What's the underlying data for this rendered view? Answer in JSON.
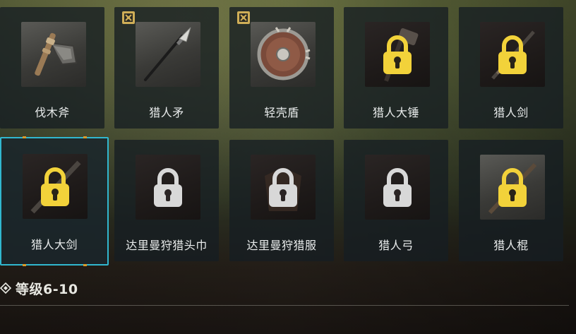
{
  "items": [
    {
      "name": "伐木斧",
      "locked": false,
      "icon": "axe-icon"
    },
    {
      "name": "猎人矛",
      "locked": false,
      "icon": "spear-icon",
      "badge": "book-icon"
    },
    {
      "name": "轻壳盾",
      "locked": false,
      "icon": "shield-icon",
      "badge": "book-icon"
    },
    {
      "name": "猎人大锤",
      "locked": true,
      "icon": "hammer-icon"
    },
    {
      "name": "猎人剑",
      "locked": true,
      "icon": "sword-icon"
    },
    {
      "name": "猎人大剑",
      "locked": true,
      "icon": "greatsword-icon",
      "selected": true
    },
    {
      "name": "达里曼狩猎头巾",
      "locked": true,
      "icon": "headscarf-icon"
    },
    {
      "name": "达里曼狩猎服",
      "locked": true,
      "icon": "hunting-clothes-icon"
    },
    {
      "name": "猎人弓",
      "locked": true,
      "icon": "bow-icon"
    },
    {
      "name": "猎人棍",
      "locked": true,
      "icon": "staff-icon"
    }
  ],
  "section": {
    "title": "等级6-10"
  },
  "colors": {
    "selected_border": "#31b7cf",
    "lock_gold": "#f2d23a",
    "lock_grey": "#d8d8d8",
    "corner": "#d99a2a"
  }
}
